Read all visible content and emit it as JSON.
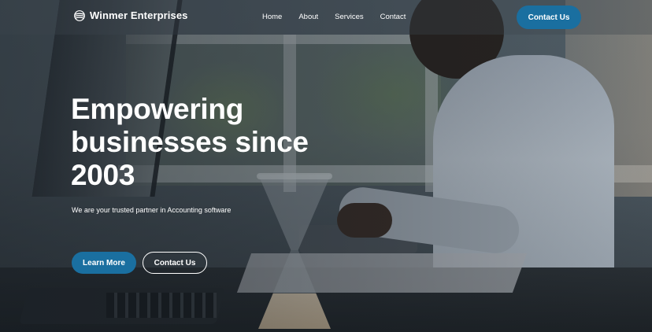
{
  "header": {
    "brand_name": "Winmer Enterprises",
    "brand_icon": "globe-logo-icon",
    "nav": [
      {
        "label": "Home"
      },
      {
        "label": "About"
      },
      {
        "label": "Services"
      },
      {
        "label": "Contact"
      }
    ],
    "cta_label": "Contact Us"
  },
  "hero": {
    "headline": "Empowering businesses since 2003",
    "subtitle": "We are your trusted partner in Accounting software",
    "primary_button": "Learn More",
    "secondary_button": "Contact Us"
  },
  "colors": {
    "accent": "#1a6fa0",
    "text": "#ffffff"
  }
}
